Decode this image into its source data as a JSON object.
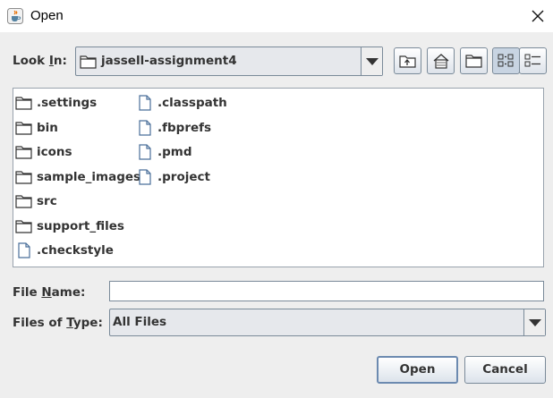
{
  "window": {
    "title": "Open",
    "app_icon": "java-cup-icon",
    "close_icon": "close-icon"
  },
  "look_in": {
    "label_pre": "Look ",
    "label_mnemonic": "I",
    "label_post": "n:",
    "value": "jassell-assignment4",
    "icon": "folder-icon"
  },
  "toolbar": [
    "up-one-level-icon",
    "home-icon",
    "new-folder-icon",
    "list-view-icon",
    "details-view-icon"
  ],
  "files": [
    {
      "name": ".settings",
      "type": "folder"
    },
    {
      "name": "bin",
      "type": "folder"
    },
    {
      "name": "icons",
      "type": "folder"
    },
    {
      "name": "sample_images",
      "type": "folder"
    },
    {
      "name": "src",
      "type": "folder"
    },
    {
      "name": "support_files",
      "type": "folder"
    },
    {
      "name": ".checkstyle",
      "type": "file"
    },
    {
      "name": ".classpath",
      "type": "file"
    },
    {
      "name": ".fbprefs",
      "type": "file"
    },
    {
      "name": ".pmd",
      "type": "file"
    },
    {
      "name": ".project",
      "type": "file"
    }
  ],
  "file_name": {
    "label_pre": "File ",
    "label_mnemonic": "N",
    "label_post": "ame:",
    "value": ""
  },
  "files_of_type": {
    "label_pre": "Files of ",
    "label_mnemonic": "T",
    "label_post": "ype:",
    "value": "All Files"
  },
  "buttons": {
    "open": "Open",
    "cancel": "Cancel"
  },
  "colors": {
    "background": "#eeeeee",
    "border": "#7a8a99",
    "text": "#333333",
    "default_button_border": "#6c8ab0"
  }
}
